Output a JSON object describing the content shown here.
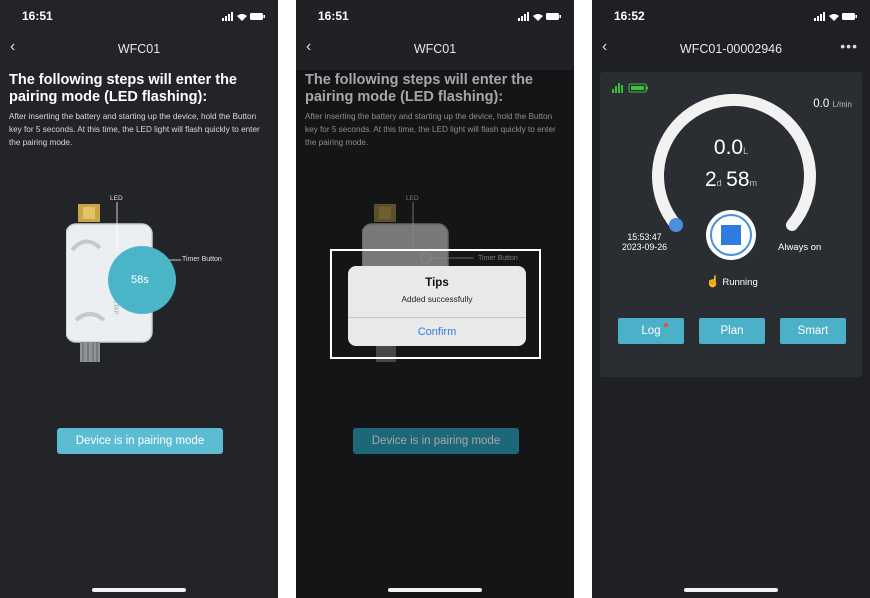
{
  "screens": [
    {
      "status_time": "16:51",
      "nav_title": "WFC01",
      "heading": "The following steps will enter the pairing mode (LED flashing):",
      "description": "After inserting the battery and starting up the device, hold the Button key for 5 seconds. At this time, the LED light will flash quickly to enter the pairing mode.",
      "led_label": "LED",
      "timer_label": "Timer Button",
      "countdown": "58s",
      "pair_button": "Device is in pairing mode"
    },
    {
      "status_time": "16:51",
      "nav_title": "WFC01",
      "heading": "The following steps will enter the pairing mode (LED flashing):",
      "description": "After inserting the battery and starting up the device, hold the Button key for 5 seconds. At this time, the LED light will flash quickly to enter the pairing mode.",
      "led_label": "LED",
      "timer_label": "Timer Button",
      "pair_button": "Device is in pairing mode",
      "dialog": {
        "title": "Tips",
        "message": "Added successfully",
        "confirm": "Confirm"
      }
    },
    {
      "status_time": "16:52",
      "nav_title": "WFC01-00002946",
      "more_icon": "more-icon",
      "flow_value": "0.0",
      "flow_unit": "L/min",
      "volume_value": "0.0",
      "volume_unit": "L",
      "days_value": "2",
      "days_unit": "d",
      "minutes_value": "58",
      "minutes_unit": "m",
      "start_time": "15:53:47",
      "start_date": "2023-09-26",
      "mode_label": "Always on",
      "status_label": "Running",
      "buttons": {
        "log": "Log",
        "plan": "Plan",
        "smart": "Smart"
      }
    }
  ],
  "colors": {
    "accent": "#4bb1c9",
    "dialog_link": "#2f7be0",
    "battery_green": "#3ac13a"
  }
}
